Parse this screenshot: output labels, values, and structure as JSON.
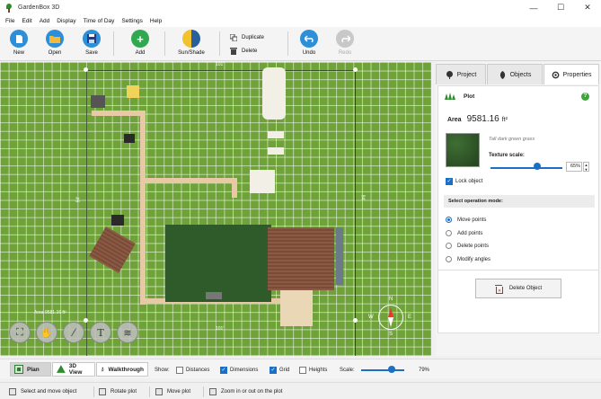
{
  "window": {
    "title": "GardenBox 3D",
    "minimize": "—",
    "maximize": "☐",
    "close": "✕"
  },
  "menu": [
    "File",
    "Edit",
    "Add",
    "Display",
    "Time of Day",
    "Settings",
    "Help"
  ],
  "toolbar": {
    "new": "New",
    "open": "Open",
    "save": "Save",
    "add": "Add",
    "sun_shade": "Sun/Shade",
    "duplicate": "Duplicate",
    "delete": "Delete",
    "undo": "Undo",
    "redo": "Redo"
  },
  "canvas": {
    "dim_top": "101'",
    "dim_bottom": "101'",
    "dim_left": "94'",
    "dim_right": "94'",
    "area_label": "Area 9581.16 ft²",
    "compass": {
      "n": "N",
      "s": "S",
      "e": "E",
      "w": "W"
    },
    "text_tool": "T"
  },
  "panel": {
    "tabs": [
      "Project",
      "Objects",
      "Properties"
    ],
    "title": "Plot",
    "help": "?",
    "area_label": "Area",
    "area_value": "9581.16",
    "area_unit": "ft²",
    "texture_name": "Tall dark green grass",
    "texture_scale_label": "Texture scale:",
    "texture_scale_value": "65%",
    "texture_scale": 0.65,
    "lock_label": "Lock object",
    "lock_checked": true,
    "opmode_title": "Select operation mode:",
    "modes": [
      "Move points",
      "Add points",
      "Delete points",
      "Modify angles"
    ],
    "selected_mode": "Move points",
    "delete_object": "Delete Object"
  },
  "viewbar": {
    "plan": "Plan",
    "view3d": "3D View",
    "walkthrough": "Walkthrough",
    "show_label": "Show:",
    "toggles": [
      {
        "label": "Distances",
        "checked": false
      },
      {
        "label": "Dimensions",
        "checked": true
      },
      {
        "label": "Grid",
        "checked": true
      },
      {
        "label": "Heights",
        "checked": false
      }
    ],
    "scale_label": "Scale:",
    "scale_value": "79%"
  },
  "status": [
    "Select and move object",
    "Rotate plot",
    "Move plot",
    "Zoom in or out on the plot"
  ],
  "colors": {
    "accent": "#1b6fc7",
    "grass": "#6fa33a",
    "add_green": "#2fa84f"
  }
}
